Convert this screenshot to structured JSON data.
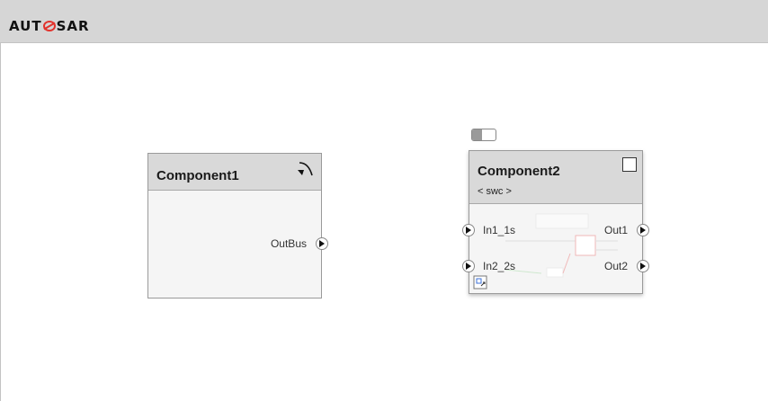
{
  "header": {
    "logo_text_left": "AUT",
    "logo_text_right": "SAR"
  },
  "component1": {
    "title": "Component1",
    "out_port": "OutBus",
    "icon": "arrow-curve-icon"
  },
  "component2": {
    "title": "Component2",
    "stereotype": "< swc >",
    "in_ports": [
      "In1_1s",
      "In2_2s"
    ],
    "out_ports": [
      "Out1",
      "Out2"
    ],
    "icon": "square-icon"
  },
  "colors": {
    "logo_accent": "#e2332d",
    "header_bg": "#d6d6d6",
    "block_bg": "#f5f5f5"
  }
}
